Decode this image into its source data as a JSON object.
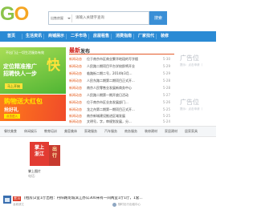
{
  "logo": {
    "part1": "G",
    "part2": "O"
  },
  "search": {
    "category": "出售房屋",
    "placeholder": "请输入关键字查询",
    "button_label": "搜索"
  },
  "nav": {
    "items": [
      "首页",
      "生活资讯",
      "商铺展示",
      "二手市场",
      "房屋租售",
      "消费指南",
      "厂家找代",
      "装修"
    ]
  },
  "banner1": {
    "headline": "不出门让一切生活服务有效",
    "big": "定位精准推广\n招聘快人一步",
    "accent": "快",
    "tag": "马上开始"
  },
  "banner2": {
    "line1": "购物送大红包",
    "line2": "抢好礼",
    "button": "点击进入"
  },
  "news": {
    "header": "发布",
    "header_prefix": "最新",
    "items": [
      {
        "category": "新闻动态",
        "title": "位于南京市区商业繁华地段的写字楼",
        "date": "5-30"
      },
      {
        "category": "新闻动态",
        "title": "人民路二期项目平台学校即将开业",
        "date": "5-29"
      },
      {
        "category": "新闻动态",
        "title": "临路街二期二号，2014年3月...",
        "date": "5-29"
      },
      {
        "category": "新闻动态",
        "title": "人民东路二期第二期项目正式开...",
        "date": "5-28"
      },
      {
        "category": "新闻动态",
        "title": "南京人民零售业发展新商务中心",
        "date": "5-28"
      },
      {
        "category": "新闻动态",
        "title": "人民路二期第一期开放日活动",
        "date": "5-27"
      },
      {
        "category": "新闻动态",
        "title": "位于南京市区业务发展部门...",
        "date": "5-26"
      },
      {
        "category": "新闻动态",
        "title": "龙之舟第二期第一期项目正式开...",
        "date": "5-25"
      },
      {
        "category": "新闻动态",
        "title": "南京新城建设推进区域发展",
        "date": "5-25"
      },
      {
        "category": "新闻动态",
        "title": "文明号，字，审规划发展，分...",
        "date": "5-24"
      },
      {
        "category": "新闻动态",
        "title": "人民路二期商业环境规划方案",
        "date": "5-24"
      }
    ]
  },
  "ads": [
    {
      "big": "广告位",
      "small": "提示：点击申请（"
    },
    {
      "big": "广告位",
      "small": "提示：点击申请（"
    }
  ],
  "category_bar": {
    "items": [
      "餐饮美食",
      "休闲娱乐",
      "教育培训",
      "美容美体",
      "家政服务",
      "汽车服务",
      "商务服务",
      "装修建材",
      "家居建材",
      "居家家具"
    ]
  },
  "product_card": {
    "img_text1": "掌上\n浙江",
    "img_text2": "出\n行",
    "title": "掌上图片",
    "phone": "电话:"
  },
  "listing": {
    "badge": "置顶",
    "title": "[租房]2室1厅出租：丹阳路龙城滨江办公300米有一间两室1厅1厅，1套...",
    "meta": "龙城滨江",
    "user": "随时出行出租中心"
  }
}
